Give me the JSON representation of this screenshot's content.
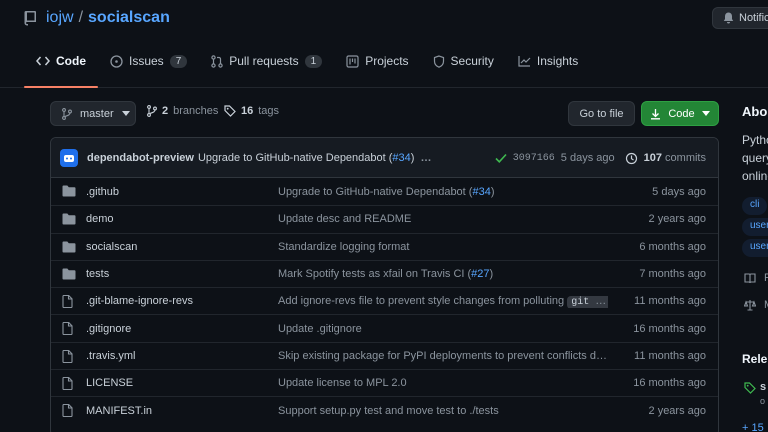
{
  "repo": {
    "owner": "iojw",
    "separator": "/",
    "name": "socialscan",
    "notifications_label": "Notifications"
  },
  "tabs": [
    {
      "label": "Code",
      "icon": "code-icon"
    },
    {
      "label": "Issues",
      "count": "7",
      "icon": "issue-icon"
    },
    {
      "label": "Pull requests",
      "count": "1",
      "icon": "pull-request-icon"
    },
    {
      "label": "Projects",
      "icon": "project-icon"
    },
    {
      "label": "Security",
      "icon": "shield-icon"
    },
    {
      "label": "Insights",
      "icon": "graph-icon"
    }
  ],
  "toolbar": {
    "branch": "master",
    "branches_count": "2",
    "branches_label": "branches",
    "tags_count": "16",
    "tags_label": "tags",
    "goto_label": "Go to file",
    "code_label": "Code"
  },
  "latest_commit": {
    "author": "dependabot-preview",
    "message": "Upgrade to GitHub-native Dependabot (",
    "pr": "#34",
    "close": ")",
    "ellipsis": "…",
    "sha": "3097166",
    "age": "5 days ago",
    "commits_count": "107",
    "commits_label": "commits"
  },
  "files": [
    {
      "type": "dir",
      "name": ".github",
      "msg": "Upgrade to GitHub-native Dependabot (",
      "pr": "#34",
      "msg_end": ")",
      "age": "5 days ago"
    },
    {
      "type": "dir",
      "name": "demo",
      "msg": "Update desc and README",
      "age": "2 years ago"
    },
    {
      "type": "dir",
      "name": "socialscan",
      "msg": "Standardize logging format",
      "age": "6 months ago"
    },
    {
      "type": "dir",
      "name": "tests",
      "msg": "Mark Spotify tests as xfail on Travis CI (",
      "pr": "#27",
      "msg_end": ")",
      "age": "7 months ago"
    },
    {
      "type": "file",
      "name": ".git-blame-ignore-revs",
      "msg": "Add ignore-revs file to prevent style changes from polluting ",
      "code": "git blame",
      "age": "11 months ago"
    },
    {
      "type": "file",
      "name": ".gitignore",
      "msg": "Update .gitignore",
      "age": "16 months ago"
    },
    {
      "type": "file",
      "name": ".travis.yml",
      "msg": "Skip existing package for PyPI deployments to prevent conflicts due t…",
      "age": "11 months ago"
    },
    {
      "type": "file",
      "name": "LICENSE",
      "msg": "Update license to MPL 2.0",
      "age": "16 months ago"
    },
    {
      "type": "file",
      "name": "MANIFEST.in",
      "msg": "Support setup.py test and move test to ./tests",
      "age": "2 years ago"
    }
  ],
  "sidebar": {
    "about_title": "About",
    "description": "Python query online",
    "topics": [
      "cli",
      "user",
      "user"
    ],
    "readme_label": "R",
    "license_label": "M",
    "releases_title": "Rele",
    "release_tag": "s",
    "release_sub": "o",
    "more_releases": "+ 15"
  },
  "colors": {
    "accent": "#58a6ff",
    "primary_button": "#238636",
    "selected_tab_underline": "#f78166",
    "background": "#0d1117"
  }
}
